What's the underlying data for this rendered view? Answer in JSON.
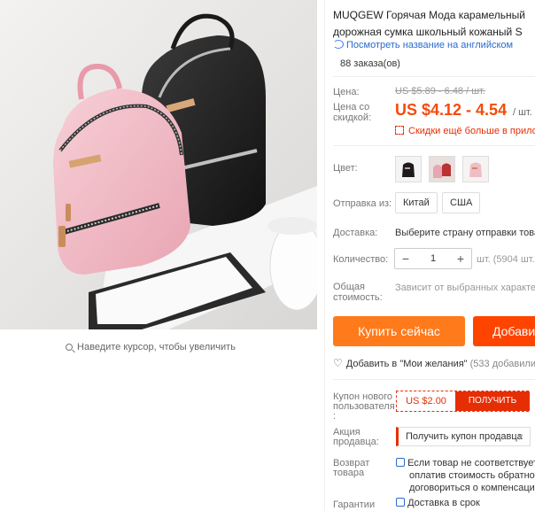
{
  "gallery": {
    "zoom_hint": "Наведите курсор, чтобы увеличить"
  },
  "product": {
    "title_line1": "MUQGEW Горячая Мода карамельный",
    "title_line2": "дорожная сумка школьный кожаный S",
    "translate_link": "Посмотреть название на английском",
    "orders": "88 заказа(ов)",
    "price_label": "Цена:",
    "old_price": "US $5.89 - 6.48 / шт.",
    "discount_label_1": "Цена со",
    "discount_label_2": "скидкой:",
    "price": "US $4.12 - 4.54",
    "price_unit": "/ шт.",
    "app_promo": "Скидки ещё больше в прило",
    "color_label": "Цвет:",
    "ship_from_label": "Отправка из:",
    "ship_from_options": [
      "Китай",
      "США"
    ],
    "delivery_label": "Доставка:",
    "delivery_value": "Выберите страну отправки товар",
    "quantity_label": "Количество:",
    "quantity": "1",
    "minus": "−",
    "plus": "+",
    "stock": "шт. (5904 шт.",
    "total_label_1": "Общая",
    "total_label_2": "стоимость:",
    "total_value": "Зависит от выбранных характер",
    "buy_now": "Купить сейчас",
    "add_to_cart": "Добави",
    "wishlist": "Добавить в \"Мои желания\"",
    "wishlist_count": "(533 добавили)",
    "new_user_coupon_label": [
      "Купон нового",
      "пользователя",
      ":"
    ],
    "coupon_amount": "US $2.00",
    "coupon_get": "ПОЛУЧИТЬ",
    "seller_promo_label": [
      "Акция",
      "продавца:"
    ],
    "seller_coupon": "Получить купон продавца",
    "returns_label": [
      "Возврат",
      "товара"
    ],
    "returns_text": [
      "Если товар не соответствует",
      "оплатив стоимость обратной",
      "договориться о компенсаци"
    ],
    "guarantee_label": "Гарантии",
    "guarantee_text": "Доставка в срок"
  },
  "colors": {
    "accent": "#f34c0a",
    "buy": "#ff7a1a",
    "cart": "#ff4400",
    "link": "#2a6ad1",
    "coupon": "#e62e04"
  }
}
